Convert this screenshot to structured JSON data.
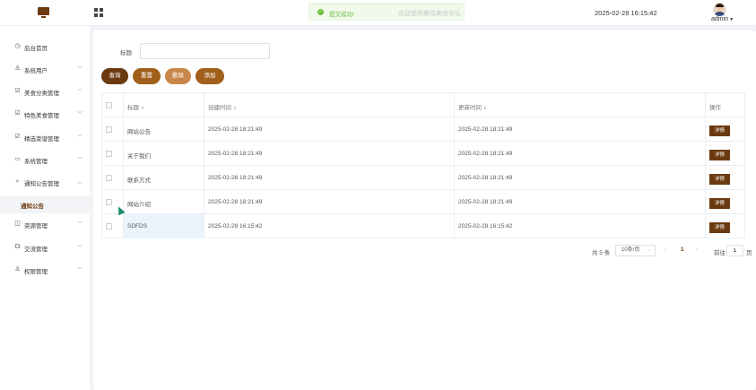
{
  "header": {
    "toast_message": "提交成功!",
    "marquee": "欢迎使用餐饮美食论坛",
    "datetime": "2025-02-28 16:15:42",
    "username": "admin"
  },
  "sidebar": {
    "items": [
      {
        "label": "后台首页",
        "icon": "clock-icon",
        "glyph": "◷"
      },
      {
        "label": "系统用户",
        "icon": "user-icon",
        "glyph": "♙"
      },
      {
        "label": "美食分类管理",
        "icon": "list-icon",
        "glyph": "☑"
      },
      {
        "label": "特色美食管理",
        "icon": "list-icon",
        "glyph": "☑"
      },
      {
        "label": "精选菜谱管理",
        "icon": "list-icon",
        "glyph": "☑"
      },
      {
        "label": "系统管理",
        "icon": "folder-icon",
        "glyph": "▭"
      },
      {
        "label": "通知公告管理",
        "icon": "search-icon",
        "glyph": "⌕"
      },
      {
        "label": "资源管理",
        "icon": "box-icon",
        "glyph": "◫"
      },
      {
        "label": "交流管理",
        "icon": "headset-icon",
        "glyph": "☊"
      },
      {
        "label": "权限管理",
        "icon": "user-icon",
        "glyph": "♙"
      }
    ],
    "active_sub": "通知公告"
  },
  "search": {
    "label": "标题",
    "value": "",
    "placeholder": ""
  },
  "buttons": {
    "query": "查询",
    "reset": "重置",
    "delete": "删除",
    "add": "添加"
  },
  "table": {
    "columns": [
      "标题",
      "创建时间",
      "更新时间",
      "操作"
    ],
    "rows": [
      {
        "title": "网站公告",
        "created": "2025-02-28 18:21:49",
        "updated": "2025-02-28 18:21:49",
        "action": "详情"
      },
      {
        "title": "关于我们",
        "created": "2025-02-28 18:21:49",
        "updated": "2025-02-28 18:21:49",
        "action": "详情"
      },
      {
        "title": "联系方式",
        "created": "2025-02-28 18:21:49",
        "updated": "2025-02-28 18:21:49",
        "action": "详情"
      },
      {
        "title": "网站介绍",
        "created": "2025-02-28 18:21:49",
        "updated": "2025-02-28 18:21:49",
        "action": "详情"
      },
      {
        "title": "SDFDS",
        "created": "2025-02-28 16:15:42",
        "updated": "2025-02-28 16:15:42",
        "action": "详情"
      }
    ]
  },
  "pagination": {
    "total": "共 5 条",
    "page_size": "10条/页",
    "current": "1",
    "goto_label": "前往",
    "goto_value": "1",
    "page_suffix": "页"
  },
  "colors": {
    "primary": "#6b3a10",
    "secondary": "#a0601a",
    "tertiary": "#c8874b",
    "success": "#67c23a"
  }
}
